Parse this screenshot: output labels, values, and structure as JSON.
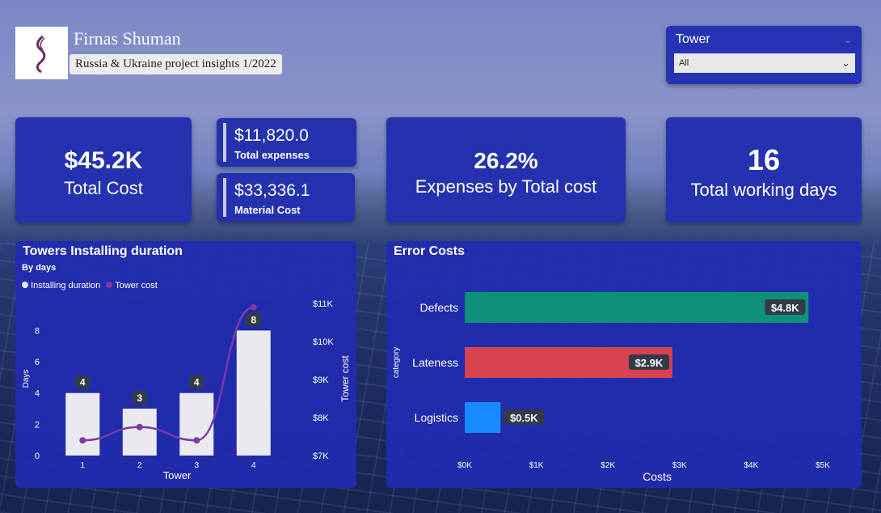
{
  "header": {
    "title": "Firnas Shuman",
    "subtitle": "Russia & Ukraine project insights 1/2022"
  },
  "slicer": {
    "title": "Tower",
    "selected": "All"
  },
  "kpis": {
    "total_cost": {
      "value": "$45.2K",
      "label": "Total Cost"
    },
    "total_expenses": {
      "value": "$11,820.0",
      "label": "Total expenses"
    },
    "material_cost": {
      "value": "$33,336.1",
      "label": "Material Cost"
    },
    "expenses_ratio": {
      "value": "26.2%",
      "label": "Expenses by Total cost"
    },
    "working_days": {
      "value": "16",
      "label": "Total working days"
    }
  },
  "chart_data": [
    {
      "type": "bar",
      "title": "Towers Installing duration",
      "subtitle": "By days",
      "legend": [
        "Installing duration",
        "Tower cost"
      ],
      "categories": [
        "1",
        "2",
        "3",
        "4"
      ],
      "series": [
        {
          "name": "Installing duration",
          "values": [
            4,
            3,
            4,
            8
          ],
          "axis": "left"
        },
        {
          "name": "Tower cost",
          "type": "line",
          "values": [
            7400,
            7750,
            7400,
            10900
          ],
          "axis": "right"
        }
      ],
      "xlabel": "Tower",
      "ylabel": "Days",
      "y2label": "Tower cost",
      "y_ticks": [
        "0",
        "2",
        "4",
        "6",
        "8"
      ],
      "y2_ticks": [
        "$7K",
        "$8K",
        "$9K",
        "$10K",
        "$11K"
      ],
      "ylim": [
        0,
        8.8
      ],
      "y2lim": [
        7000,
        11000
      ],
      "data_labels": [
        "4",
        "3",
        "4",
        "8"
      ],
      "colors": {
        "bar": "#e9e9ef",
        "line": "#7d3aa7"
      }
    },
    {
      "type": "bar",
      "orientation": "horizontal",
      "title": "Error Costs",
      "categories": [
        "Defects",
        "Lateness",
        "Logistics"
      ],
      "values": [
        4800,
        2900,
        500
      ],
      "data_labels": [
        "$4.8K",
        "$2.9K",
        "$0.5K"
      ],
      "xlabel": "Costs",
      "ylabel": "category",
      "x_ticks": [
        "$0K",
        "$1K",
        "$2K",
        "$3K",
        "$4K",
        "$5K"
      ],
      "xlim": [
        0,
        5000
      ],
      "colors": [
        "#0f9079",
        "#d8434f",
        "#168bff"
      ]
    }
  ]
}
